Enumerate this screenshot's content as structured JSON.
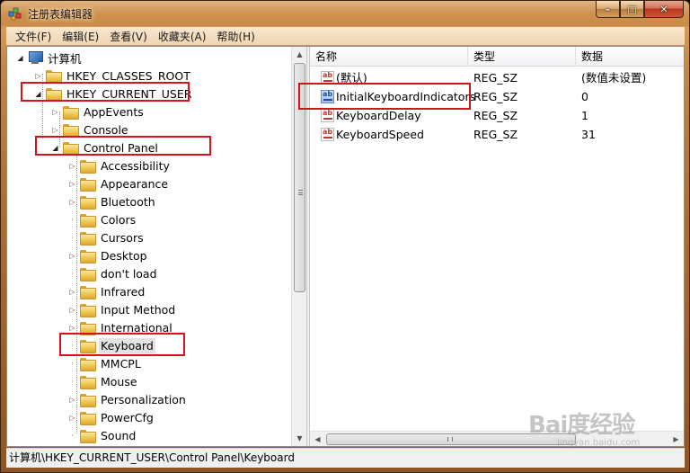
{
  "window": {
    "title": "注册表编辑器",
    "buttons": {
      "minimize": "–",
      "maximize": "□",
      "close": "✕"
    }
  },
  "menu": [
    {
      "label": "文件(F)"
    },
    {
      "label": "编辑(E)"
    },
    {
      "label": "查看(V)"
    },
    {
      "label": "收藏夹(A)"
    },
    {
      "label": "帮助(H)"
    }
  ],
  "tree": {
    "root": "计算机",
    "hives": [
      {
        "label": "HKEY_CLASSES_ROOT"
      },
      {
        "label": "HKEY_CURRENT_USER"
      }
    ],
    "level2": [
      {
        "label": "AppEvents"
      },
      {
        "label": "Console"
      },
      {
        "label": "Control Panel"
      }
    ],
    "control_panel_children": [
      {
        "label": "Accessibility",
        "has_children": true
      },
      {
        "label": "Appearance",
        "has_children": true
      },
      {
        "label": "Bluetooth",
        "has_children": true
      },
      {
        "label": "Colors",
        "has_children": false
      },
      {
        "label": "Cursors",
        "has_children": false
      },
      {
        "label": "Desktop",
        "has_children": true
      },
      {
        "label": "don't load",
        "has_children": false
      },
      {
        "label": "Infrared",
        "has_children": true
      },
      {
        "label": "Input Method",
        "has_children": true
      },
      {
        "label": "International",
        "has_children": true
      },
      {
        "label": "Keyboard",
        "has_children": false,
        "selected": true
      },
      {
        "label": "MMCPL",
        "has_children": false
      },
      {
        "label": "Mouse",
        "has_children": false
      },
      {
        "label": "Personalization",
        "has_children": true
      },
      {
        "label": "PowerCfg",
        "has_children": true
      },
      {
        "label": "Sound",
        "has_children": false
      }
    ]
  },
  "list": {
    "columns": {
      "name": "名称",
      "type": "类型",
      "data": "数据"
    },
    "rows": [
      {
        "name": "(默认)",
        "type": "REG_SZ",
        "data": "(数值未设置)",
        "icon": "string-value-icon"
      },
      {
        "name": "InitialKeyboardIndicators",
        "type": "REG_SZ",
        "data": "0",
        "icon": "string-value-icon"
      },
      {
        "name": "KeyboardDelay",
        "type": "REG_SZ",
        "data": "1",
        "icon": "string-value-icon"
      },
      {
        "name": "KeyboardSpeed",
        "type": "REG_SZ",
        "data": "31",
        "icon": "string-value-icon"
      }
    ]
  },
  "status": {
    "path": "计算机\\HKEY_CURRENT_USER\\Control Panel\\Keyboard"
  },
  "watermark": {
    "brand": "Bai度经验",
    "url": "jingyan.baidu.com"
  },
  "colors": {
    "highlight": "#d4141b",
    "frame": "#b9773a"
  }
}
